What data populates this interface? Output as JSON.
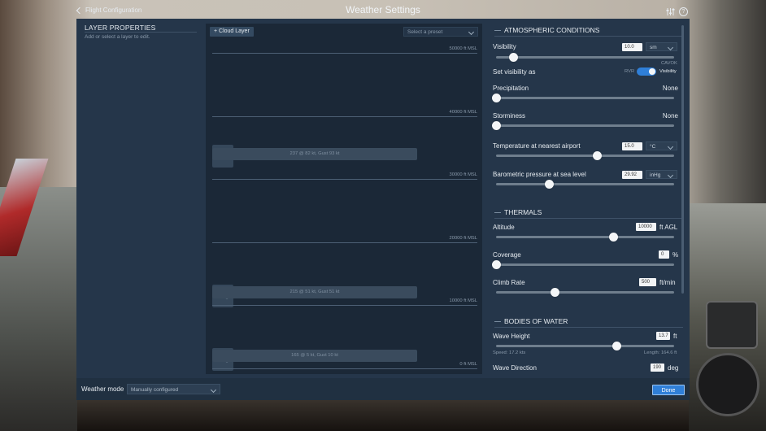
{
  "header": {
    "back_label": "Flight Configuration",
    "title": "Weather Settings"
  },
  "layer_properties": {
    "title": "LAYER PROPERTIES",
    "hint": "Add or select a layer to edit."
  },
  "layers": {
    "add_cloud_label": "+ Cloud Layer",
    "preset_placeholder": "Select a preset",
    "altitudes": [
      "50000 ft MSL",
      "40000 ft MSL",
      "30000 ft MSL",
      "20000 ft MSL",
      "10000 ft MSL",
      "0 ft MSL"
    ],
    "wind_layers": [
      "237 @ 82 kt, Gust 93 kt",
      "215 @ 51 kt, Gust 51 kt",
      "165 @ 5 kt, Gust 10 kt"
    ]
  },
  "atmospheric": {
    "title": "ATMOSPHERIC CONDITIONS",
    "visibility": {
      "label": "Visibility",
      "value": "10.0",
      "unit": "sm",
      "level": 0.1,
      "marker": "CAVOK"
    },
    "visibility_mode": {
      "label": "Set visibility as",
      "off_label": "RVR",
      "on_label": "Visibility",
      "on": true
    },
    "precipitation": {
      "label": "Precipitation",
      "value": "None",
      "level": 0.0
    },
    "storminess": {
      "label": "Storminess",
      "value": "None",
      "level": 0.0
    },
    "temperature": {
      "label": "Temperature at nearest airport",
      "value": "15.0",
      "unit": "°C",
      "level": 0.57
    },
    "pressure": {
      "label": "Barometric pressure at sea level",
      "value": "29.92",
      "unit": "inHg",
      "level": 0.3
    }
  },
  "thermals": {
    "title": "THERMALS",
    "altitude": {
      "label": "Altitude",
      "value": "10000",
      "unit": "ft AGL",
      "level": 0.66
    },
    "coverage": {
      "label": "Coverage",
      "value": "0",
      "unit": "%",
      "level": 0.0
    },
    "climb_rate": {
      "label": "Climb Rate",
      "value": "500",
      "unit": "ft/min",
      "level": 0.33
    }
  },
  "water": {
    "title": "BODIES OF WATER",
    "wave_height": {
      "label": "Wave Height",
      "value": "13.7",
      "unit": "ft",
      "level": 0.68,
      "speed_text": "Speed: 17.2 kts",
      "length_text": "Length: 164.6 ft"
    },
    "wave_direction": {
      "label": "Wave Direction",
      "value": "190",
      "unit": "deg"
    }
  },
  "footer": {
    "mode_label": "Weather mode",
    "mode_value": "Manually configured",
    "done_label": "Done"
  },
  "colors": {
    "panel": "#25364a",
    "layers_bg": "#1b2837",
    "accent": "#2f7fd8"
  }
}
